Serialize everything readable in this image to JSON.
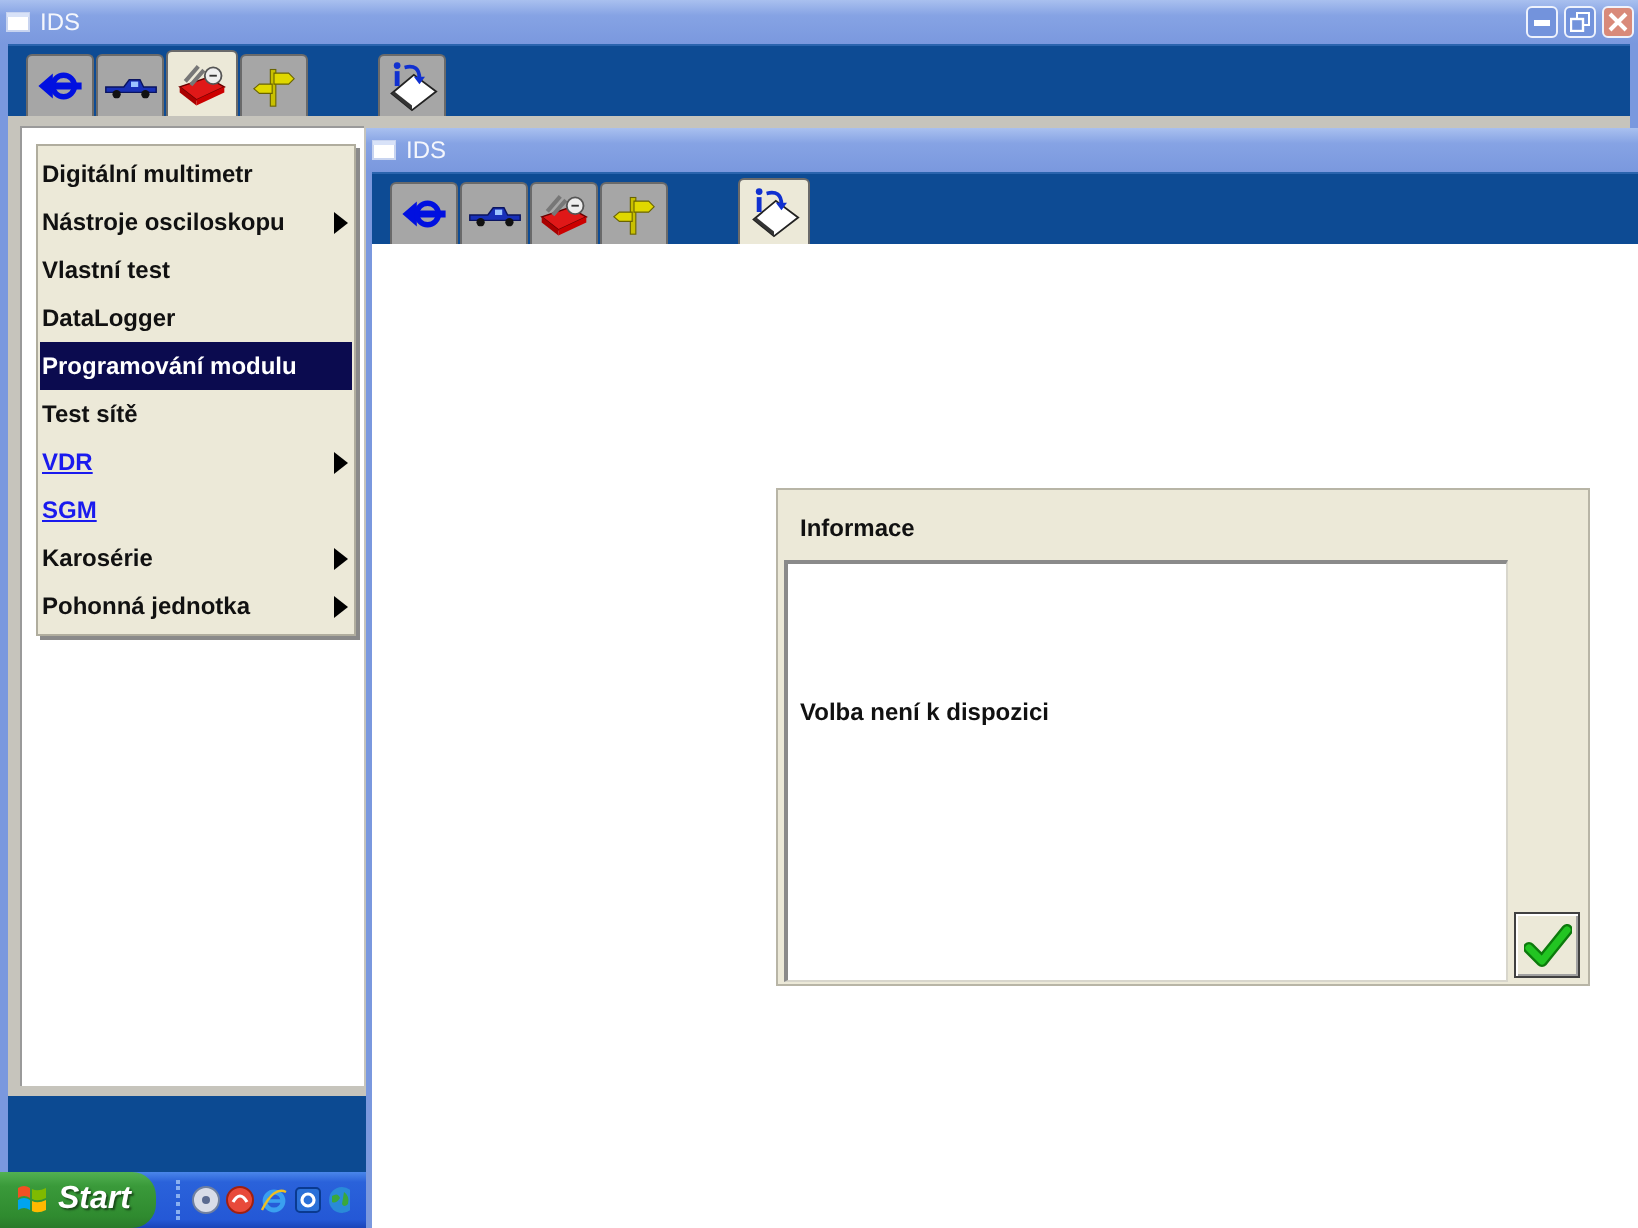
{
  "main_window": {
    "title": "IDS",
    "tabs": [
      {
        "kind": "connector",
        "selected": false
      },
      {
        "kind": "vehicle",
        "selected": false
      },
      {
        "kind": "toolbox",
        "selected": true
      },
      {
        "kind": "signpost",
        "selected": false
      },
      {
        "kind": "info",
        "selected": false
      }
    ]
  },
  "menu": {
    "items": [
      {
        "label": "Digitální multimetr",
        "kind": "text",
        "has_submenu": false,
        "selected": false
      },
      {
        "label": "Nástroje osciloskopu",
        "kind": "text",
        "has_submenu": true,
        "selected": false
      },
      {
        "label": "Vlastní test",
        "kind": "text",
        "has_submenu": false,
        "selected": false
      },
      {
        "label": "DataLogger",
        "kind": "text",
        "has_submenu": false,
        "selected": false
      },
      {
        "label": "Programování modulu",
        "kind": "text",
        "has_submenu": false,
        "selected": true
      },
      {
        "label": "Test sítě",
        "kind": "text",
        "has_submenu": false,
        "selected": false
      },
      {
        "label": "VDR",
        "kind": "link",
        "has_submenu": true,
        "selected": false
      },
      {
        "label": "SGM",
        "kind": "link",
        "has_submenu": false,
        "selected": false
      },
      {
        "label": "Karosérie",
        "kind": "text",
        "has_submenu": true,
        "selected": false
      },
      {
        "label": "Pohonná jednotka",
        "kind": "text",
        "has_submenu": true,
        "selected": false
      }
    ]
  },
  "ids_window": {
    "title": "IDS",
    "tabs": [
      {
        "kind": "connector",
        "selected": false
      },
      {
        "kind": "vehicle",
        "selected": false
      },
      {
        "kind": "toolbox",
        "selected": false
      },
      {
        "kind": "signpost",
        "selected": false
      },
      {
        "kind": "info",
        "selected": true
      }
    ]
  },
  "dialog": {
    "title": "Informace",
    "message": "Volba není k dispozici"
  },
  "taskbar": {
    "start_label": "Start"
  }
}
